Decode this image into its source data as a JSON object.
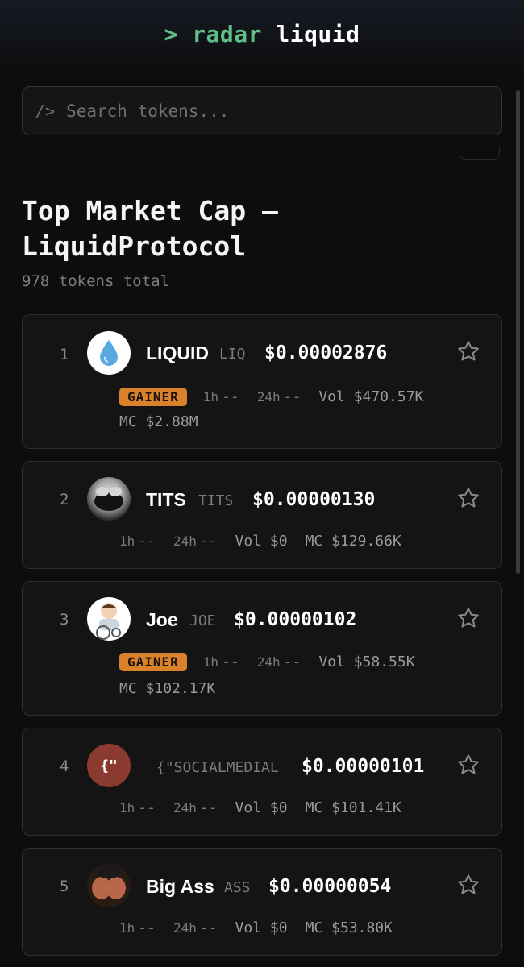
{
  "header": {
    "prompt": ">",
    "brand_word": "radar",
    "brand_name": "liquid"
  },
  "search": {
    "prefix": "/>",
    "placeholder": "Search tokens..."
  },
  "page": {
    "title": "Top Market Cap — LiquidProtocol",
    "subtitle": "978 tokens total"
  },
  "labels": {
    "h1": "1h",
    "h24": "24h",
    "dash": "--",
    "vol": "Vol",
    "mc": "MC",
    "gainer": "GAINER"
  },
  "tokens": [
    {
      "rank": "1",
      "name": "LIQUID",
      "symbol": "LIQ",
      "price": "$0.00002876",
      "volume": "$470.57K",
      "mcap": "$2.88M",
      "gainer": true
    },
    {
      "rank": "2",
      "name": "TITS",
      "symbol": "TITS",
      "price": "$0.00000130",
      "volume": "$0",
      "mcap": "$129.66K",
      "gainer": false
    },
    {
      "rank": "3",
      "name": "Joe",
      "symbol": "JOE",
      "price": "$0.00000102",
      "volume": "$58.55K",
      "mcap": "$102.17K",
      "gainer": true
    },
    {
      "rank": "4",
      "name": "",
      "symbol": "{\"SOCIALMEDIAL",
      "price": "$0.00000101",
      "volume": "$0",
      "mcap": "$101.41K",
      "gainer": false,
      "avatar_text": "{\""
    },
    {
      "rank": "5",
      "name": "Big Ass",
      "symbol": "ASS",
      "price": "$0.00000054",
      "volume": "$0",
      "mcap": "$53.80K",
      "gainer": false
    }
  ],
  "colors": {
    "accent": "#5fbf86",
    "gainer": "#d9822b",
    "background": "#0d0d0d",
    "card": "#141414"
  }
}
